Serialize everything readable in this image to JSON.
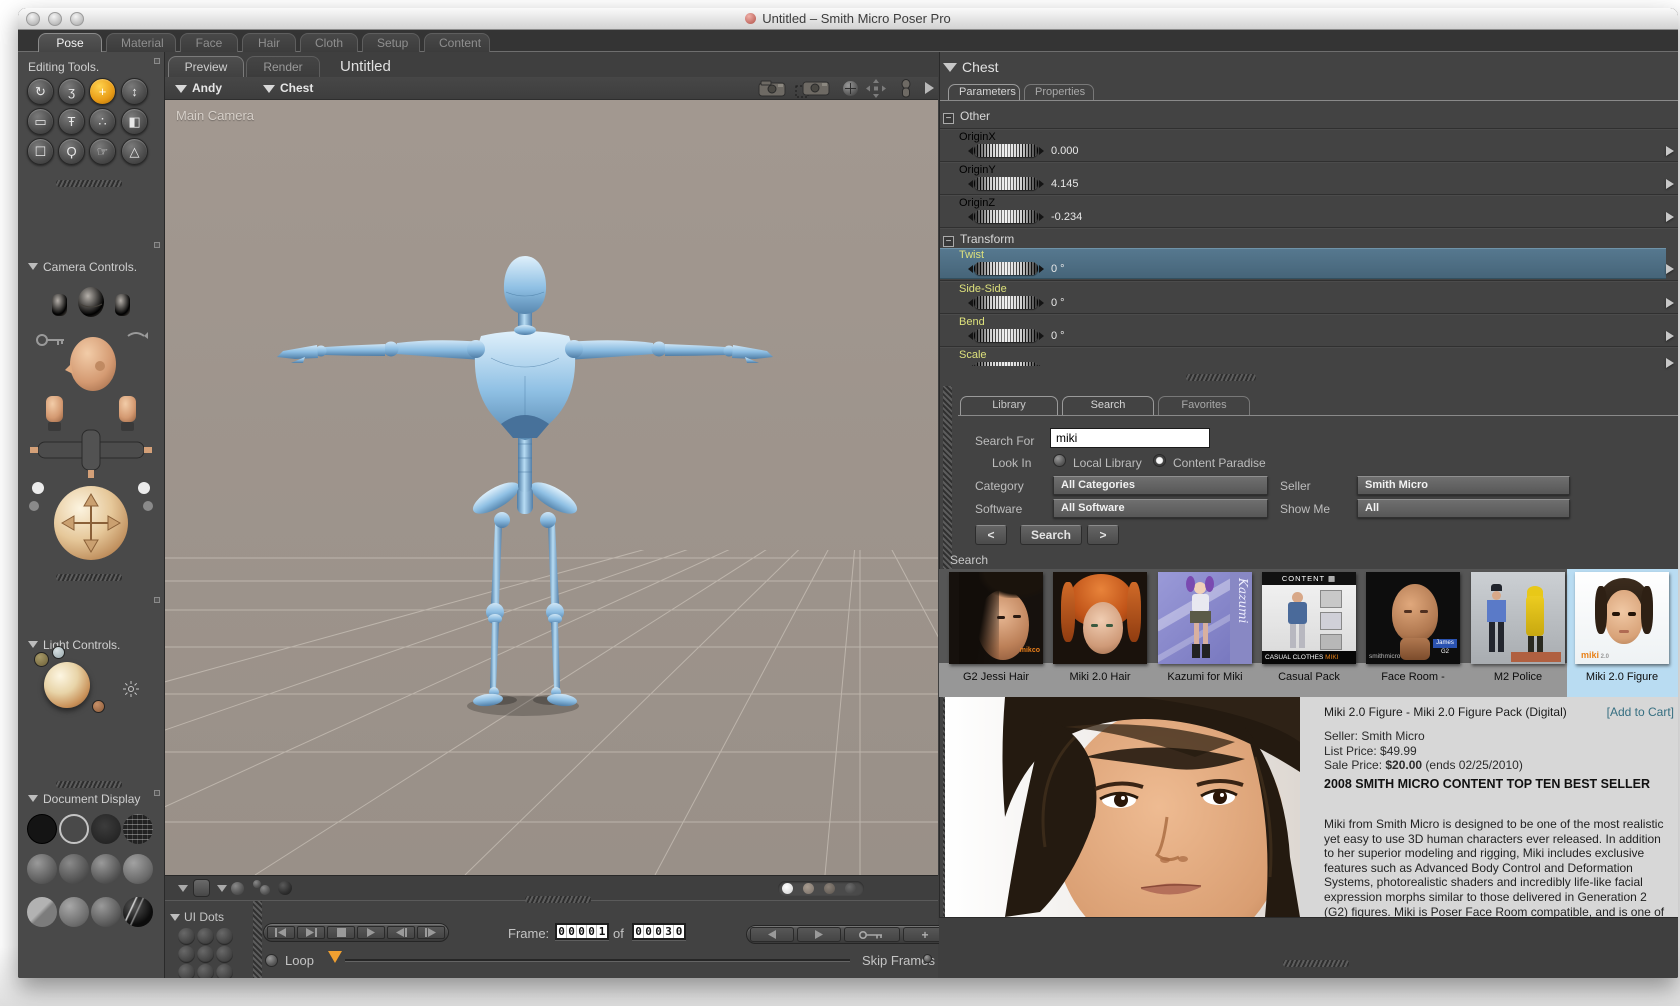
{
  "window": {
    "title": "Untitled – Smith Micro Poser Pro"
  },
  "main_tabs": {
    "items": [
      "Pose",
      "Material",
      "Face",
      "Hair",
      "Cloth",
      "Setup",
      "Content"
    ],
    "active": "Pose"
  },
  "sidebar": {
    "editing_tools": {
      "title": "Editing Tools.",
      "tools": [
        {
          "name": "rotate",
          "glyph": "↻"
        },
        {
          "name": "twist",
          "glyph": "ʒ"
        },
        {
          "name": "translate-pull",
          "glyph": "+",
          "selected": true
        },
        {
          "name": "translate-in-out",
          "glyph": "↕"
        },
        {
          "name": "scale",
          "glyph": "▭"
        },
        {
          "name": "taper",
          "glyph": "Ŧ"
        },
        {
          "name": "morphing-tool",
          "glyph": "∴"
        },
        {
          "name": "color",
          "glyph": "◧"
        },
        {
          "name": "grouping",
          "glyph": "☐"
        },
        {
          "name": "view-magnifier",
          "glyph": "Ϙ"
        },
        {
          "name": "direct-manipulation",
          "glyph": "☞"
        },
        {
          "name": "chain-break",
          "glyph": "△"
        }
      ]
    },
    "camera_controls": {
      "title": "Camera Controls."
    },
    "light_controls": {
      "title": "Light Controls."
    },
    "document_display": {
      "title": "Document Display"
    }
  },
  "document": {
    "tabs": [
      "Preview",
      "Render"
    ],
    "active_tab": "Preview",
    "title": "Untitled",
    "actor_menu": "Andy",
    "element_menu": "Chest",
    "camera_label": "Main Camera"
  },
  "animation": {
    "ui_dots_label": "UI Dots",
    "frame_label": "Frame:",
    "frame_current": "00001",
    "of_label": "of",
    "frame_total": "00030",
    "loop_label": "Loop",
    "skip_frames_label": "Skip Frames"
  },
  "parameters_panel": {
    "element": "Chest",
    "tabs": [
      "Parameters",
      "Properties"
    ],
    "active_tab": "Parameters",
    "groups": [
      {
        "name": "Other",
        "params": [
          {
            "label": "OriginX",
            "value": "0.000"
          },
          {
            "label": "OriginY",
            "value": "4.145"
          },
          {
            "label": "OriginZ",
            "value": "-0.234"
          }
        ]
      },
      {
        "name": "Transform",
        "params": [
          {
            "label": "Twist",
            "value": "0 °",
            "highlighted": true
          },
          {
            "label": "Side-Side",
            "value": "0 °"
          },
          {
            "label": "Bend",
            "value": "0 °"
          },
          {
            "label": "Scale",
            "value": ""
          }
        ]
      }
    ]
  },
  "library_panel": {
    "tabs": [
      "Library",
      "Search",
      "Favorites"
    ],
    "active_tab": "Search",
    "form": {
      "search_for_label": "Search For",
      "search_value": "miki",
      "look_in_label": "Look In",
      "radio_local": "Local Library",
      "radio_content": "Content Paradise",
      "selected_radio": "Content Paradise",
      "category_label": "Category",
      "category_value": "All Categories",
      "seller_label": "Seller",
      "seller_value": "Smith Micro",
      "software_label": "Software",
      "software_value": "All Software",
      "show_me_label": "Show Me",
      "show_me_value": "All",
      "prev_label": "<",
      "search_button": "Search",
      "next_label": ">"
    },
    "results_label": "Search",
    "results": [
      {
        "name": "G2 Jessi Hair"
      },
      {
        "name": "Miki 2.0 Hair"
      },
      {
        "name": "Kazumi for Miki"
      },
      {
        "name": "Casual Pack"
      },
      {
        "name": "Face Room -"
      },
      {
        "name": "M2 Police"
      },
      {
        "name": "Miki 2.0 Figure",
        "selected": true
      }
    ],
    "detail": {
      "title": "Miki 2.0 Figure - Miki 2.0 Figure Pack (Digital)",
      "add_to_cart": "[Add to Cart]",
      "seller": "Seller: Smith Micro",
      "list_price": "List Price: $49.99",
      "sale_price_label": "Sale Price:",
      "sale_price": "$20.00",
      "sale_ends": "(ends 02/25/2010)",
      "banner": "2008 SMITH MICRO CONTENT TOP TEN BEST SELLER",
      "description": "Miki from Smith Micro is designed to be one of the most realistic yet easy to use 3D human characters ever released. In addition to her superior modeling and rigging, Miki includes exclusive features such as Advanced Body Control and Deformation Systems, photorealistic shaders and incredibly life-like facial expression morphs similar to those delivered in Generation 2 (G2) figures. Miki is Poser Face Room compatible, and is one of the most advanced and versatile Poser figures ever released."
    }
  }
}
